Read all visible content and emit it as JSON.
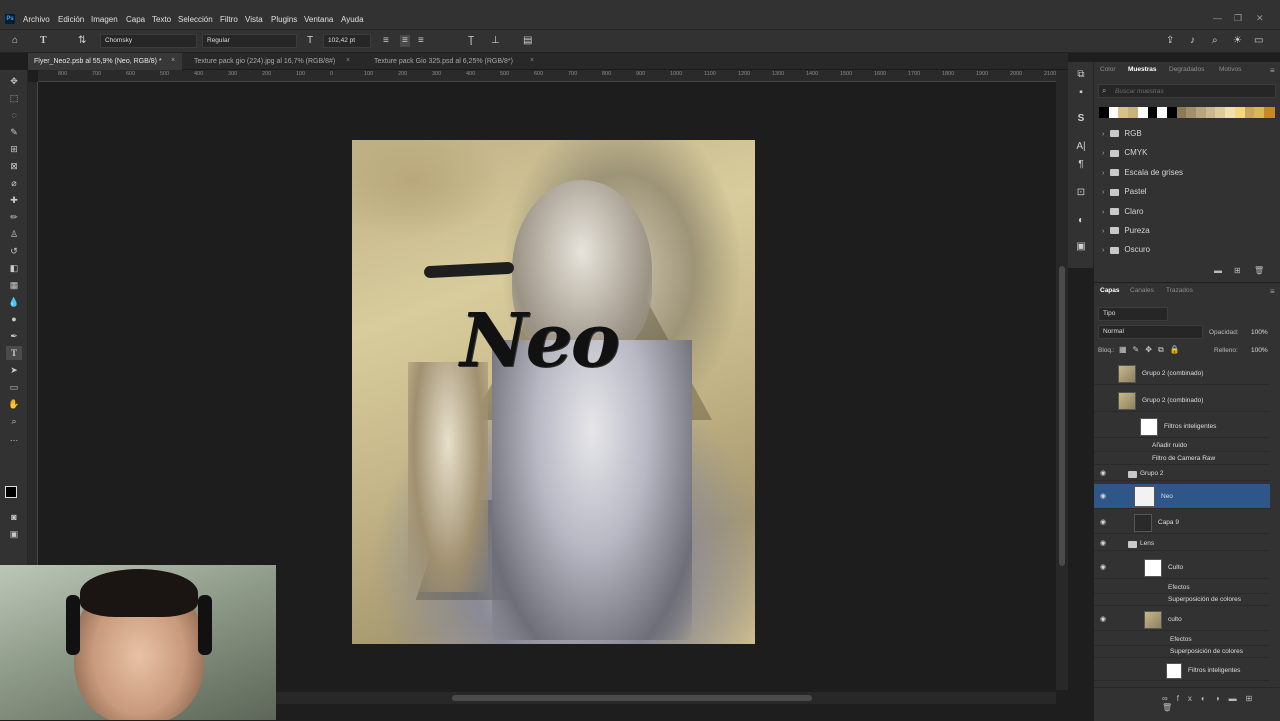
{
  "menu": {
    "items": [
      "Archivo",
      "Edición",
      "Imagen",
      "Capa",
      "Texto",
      "Selección",
      "Filtro",
      "Vista",
      "Plugins",
      "Ventana",
      "Ayuda"
    ]
  },
  "options": {
    "font_family": "Chomsky",
    "font_style": "Regular",
    "font_size": "102,42 pt"
  },
  "tabs": [
    {
      "label": "Flyer_Neo2.psb al 55,9% (Neo, RGB/8) *",
      "active": true
    },
    {
      "label": "Texture pack gio (224).jpg al 16,7% (RGB/8#)",
      "active": false
    },
    {
      "label": "Texture pack Gio 325.psd al 6,25% (RGB/8*)",
      "active": false
    }
  ],
  "ruler": {
    "marks": [
      "800",
      "700",
      "600",
      "500",
      "400",
      "300",
      "200",
      "100",
      "0",
      "100",
      "200",
      "300",
      "400",
      "500",
      "600",
      "700",
      "800",
      "900",
      "1000",
      "1100",
      "1200",
      "1300",
      "1400",
      "1500",
      "1600",
      "1700",
      "1800",
      "1900",
      "2000",
      "2100",
      "2200",
      "2300",
      "2400",
      "2500"
    ]
  },
  "canvas": {
    "headline": "Neo"
  },
  "swatches": {
    "tabs": [
      "Color",
      "Muestras",
      "Degradados",
      "Motivos"
    ],
    "active_tab": "Muestras",
    "search_placeholder": "Buscar muestras",
    "colors": [
      "#000000",
      "#ffffff",
      "#d9c18a",
      "#c8b27c",
      "#ffffff",
      "#000000",
      "#ffffff",
      "#000000",
      "#8a7a55",
      "#a0916a",
      "#b4a67e",
      "#c8b98f",
      "#dccba0",
      "#f0dfb0",
      "#f4d878",
      "#c9a85a",
      "#d8b850",
      "#c78a20"
    ],
    "folders": [
      "RGB",
      "CMYK",
      "Escala de grises",
      "Pastel",
      "Claro",
      "Pureza",
      "Oscuro"
    ]
  },
  "layers": {
    "tabs": [
      "Capas",
      "Canales",
      "Trazados"
    ],
    "active_tab": "Capas",
    "filter": "Tipo",
    "blend": "Normal",
    "opacity_label": "Opacidad:",
    "opacity": "100%",
    "lock_label": "Bloq.:",
    "fill_label": "Relleno:",
    "fill": "100%",
    "rows": [
      {
        "name": "Grupo 2 (combinado)",
        "visible": false,
        "selected": false
      },
      {
        "name": "Grupo 2 (combinado)",
        "visible": false,
        "selected": false
      },
      {
        "name": "Filtros inteligentes",
        "visible": false,
        "selected": false
      },
      {
        "name": "Añadir ruido",
        "visible": false,
        "selected": false
      },
      {
        "name": "Filtro de Camera Raw",
        "visible": false,
        "selected": false
      },
      {
        "name": "Grupo 2",
        "visible": true,
        "selected": false
      },
      {
        "name": "Neo",
        "visible": true,
        "selected": true
      },
      {
        "name": "Capa 9",
        "visible": true,
        "selected": false
      },
      {
        "name": "Lens",
        "visible": true,
        "selected": false
      },
      {
        "name": "Culto",
        "visible": true,
        "selected": false
      },
      {
        "name": "Efectos",
        "visible": false,
        "selected": false
      },
      {
        "name": "Superposición de colores",
        "visible": false,
        "selected": false
      },
      {
        "name": "culto",
        "visible": true,
        "selected": false
      },
      {
        "name": "Efectos",
        "visible": false,
        "selected": false
      },
      {
        "name": "Superposición de colores",
        "visible": false,
        "selected": false
      },
      {
        "name": "Filtros inteligentes",
        "visible": false,
        "selected": false
      }
    ]
  }
}
